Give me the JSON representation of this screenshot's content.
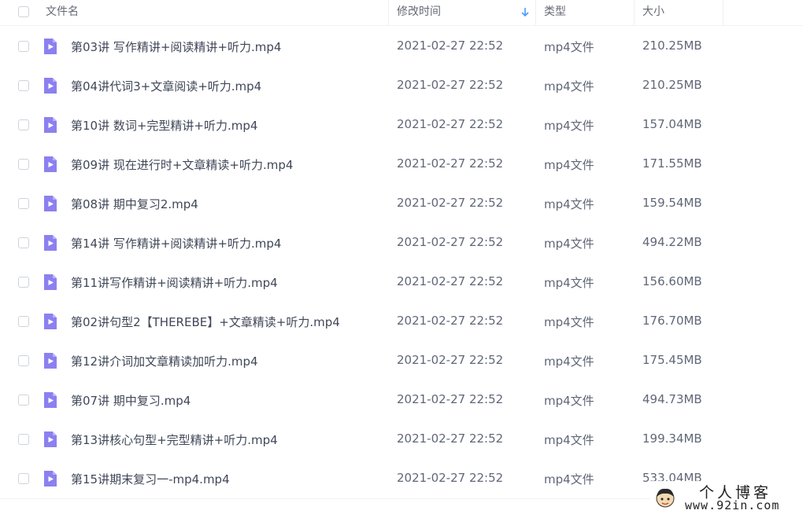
{
  "header": {
    "name": "文件名",
    "modified": "修改时间",
    "type": "类型",
    "size": "大小",
    "sort_icon": "arrow-down-icon",
    "accent": "#4b98ff"
  },
  "file_icon": "video-file-icon",
  "file_icon_color": "#8c80f0",
  "files": [
    {
      "name": "第03讲 写作精讲+阅读精讲+听力.mp4",
      "modified": "2021-02-27 22:52",
      "type": "mp4文件",
      "size": "210.25MB"
    },
    {
      "name": "第04讲代词3+文章阅读+听力.mp4",
      "modified": "2021-02-27 22:52",
      "type": "mp4文件",
      "size": "210.25MB"
    },
    {
      "name": "第10讲 数词+完型精讲+听力.mp4",
      "modified": "2021-02-27 22:52",
      "type": "mp4文件",
      "size": "157.04MB"
    },
    {
      "name": "第09讲 现在进行时+文章精读+听力.mp4",
      "modified": "2021-02-27 22:52",
      "type": "mp4文件",
      "size": "171.55MB"
    },
    {
      "name": "第08讲 期中复习2.mp4",
      "modified": "2021-02-27 22:52",
      "type": "mp4文件",
      "size": "159.54MB"
    },
    {
      "name": "第14讲 写作精讲+阅读精讲+听力.mp4",
      "modified": "2021-02-27 22:52",
      "type": "mp4文件",
      "size": "494.22MB"
    },
    {
      "name": "第11讲写作精讲+阅读精讲+听力.mp4",
      "modified": "2021-02-27 22:52",
      "type": "mp4文件",
      "size": "156.60MB"
    },
    {
      "name": "第02讲句型2【THEREBE】+文章精读+听力.mp4",
      "modified": "2021-02-27 22:52",
      "type": "mp4文件",
      "size": "176.70MB"
    },
    {
      "name": "第12讲介词加文章精读加听力.mp4",
      "modified": "2021-02-27 22:52",
      "type": "mp4文件",
      "size": "175.45MB"
    },
    {
      "name": "第07讲 期中复习.mp4",
      "modified": "2021-02-27 22:52",
      "type": "mp4文件",
      "size": "494.73MB"
    },
    {
      "name": "第13讲核心句型+完型精讲+听力.mp4",
      "modified": "2021-02-27 22:52",
      "type": "mp4文件",
      "size": "199.34MB"
    },
    {
      "name": "第15讲期末复习一-mp4.mp4",
      "modified": "2021-02-27 22:52",
      "type": "mp4文件",
      "size": "533.04MB"
    }
  ],
  "watermark": {
    "title": "个人博客",
    "url": "www.92in.com",
    "avatar_icon": "cartoon-avatar-icon"
  }
}
